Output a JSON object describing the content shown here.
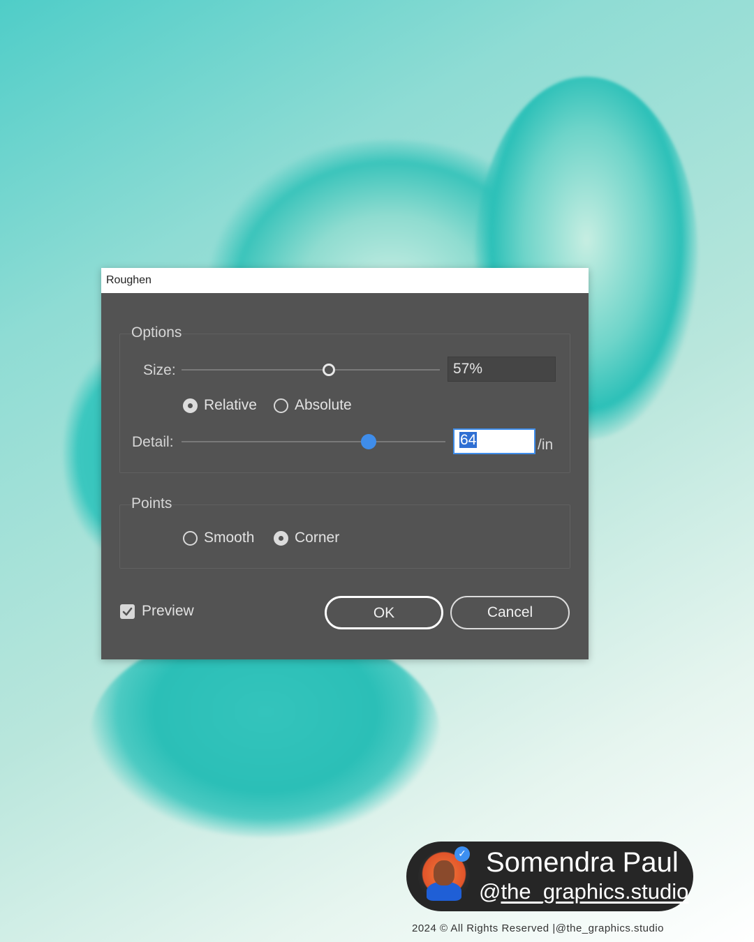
{
  "dialog": {
    "title": "Roughen",
    "options_label": "Options",
    "size_label": "Size:",
    "size_value": "57%",
    "size_slider_fraction": 0.57,
    "relative_label": "Relative",
    "absolute_label": "Absolute",
    "size_mode_selected": "Relative",
    "detail_label": "Detail:",
    "detail_value": "64",
    "detail_unit": "/in",
    "detail_slider_fraction": 0.64,
    "points_label": "Points",
    "smooth_label": "Smooth",
    "corner_label": "Corner",
    "points_selected": "Corner",
    "preview_label": "Preview",
    "preview_checked": true,
    "ok_label": "OK",
    "cancel_label": "Cancel"
  },
  "author": {
    "name": "Somendra Paul",
    "handle_prefix": "@",
    "handle": "the_graphics.studio"
  },
  "footer": {
    "copyright": "2024 © All Rights Reserved |@the_graphics.studio"
  },
  "colors": {
    "accent": "#3f8dea",
    "dialog_bg": "#535353",
    "badge_bg": "#262626"
  }
}
